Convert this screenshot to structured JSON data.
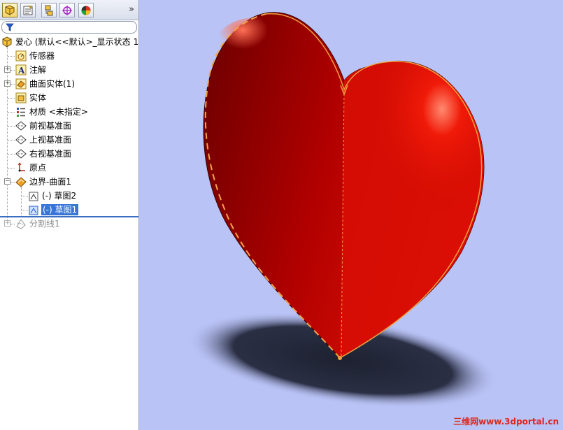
{
  "tabs": [
    {
      "name": "feature-manager",
      "active": true
    },
    {
      "name": "property-manager",
      "active": false
    },
    {
      "name": "configuration-manager",
      "active": false
    },
    {
      "name": "dimxpert-manager",
      "active": false
    },
    {
      "name": "display-manager",
      "active": false
    }
  ],
  "tabs_more": "»",
  "tree": {
    "root": "爱心  (默认<<默认>_显示状态 1",
    "items": [
      {
        "label": "传感器",
        "icon": "sensor-icon"
      },
      {
        "label": "注解",
        "icon": "annotation-icon",
        "expandable": true
      },
      {
        "label": "曲面实体(1)",
        "icon": "surface-bodies-icon",
        "expandable": true
      },
      {
        "label": "实体",
        "icon": "solid-bodies-icon"
      },
      {
        "label": "材质 <未指定>",
        "icon": "material-icon"
      },
      {
        "label": "前视基准面",
        "icon": "plane-icon"
      },
      {
        "label": "上视基准面",
        "icon": "plane-icon"
      },
      {
        "label": "右视基准面",
        "icon": "plane-icon"
      },
      {
        "label": "原点",
        "icon": "origin-icon"
      },
      {
        "label": "边界-曲面1",
        "icon": "boundary-surface-icon",
        "expanded": true
      },
      {
        "label": "(-) 草图2",
        "icon": "sketch-icon"
      },
      {
        "label": "(-) 草图1",
        "icon": "sketch-icon",
        "selected": true
      },
      {
        "label": "分割线1",
        "icon": "split-line-icon",
        "expandable": true,
        "suppressed": true
      }
    ]
  },
  "watermark": {
    "brand": "三维网",
    "url": "www.3dportal.cn"
  },
  "colors": {
    "viewport_bg": "#b9c3f6",
    "heart": "#e01206",
    "selection": "#3875d7",
    "sketch_line": "#f0a040"
  }
}
